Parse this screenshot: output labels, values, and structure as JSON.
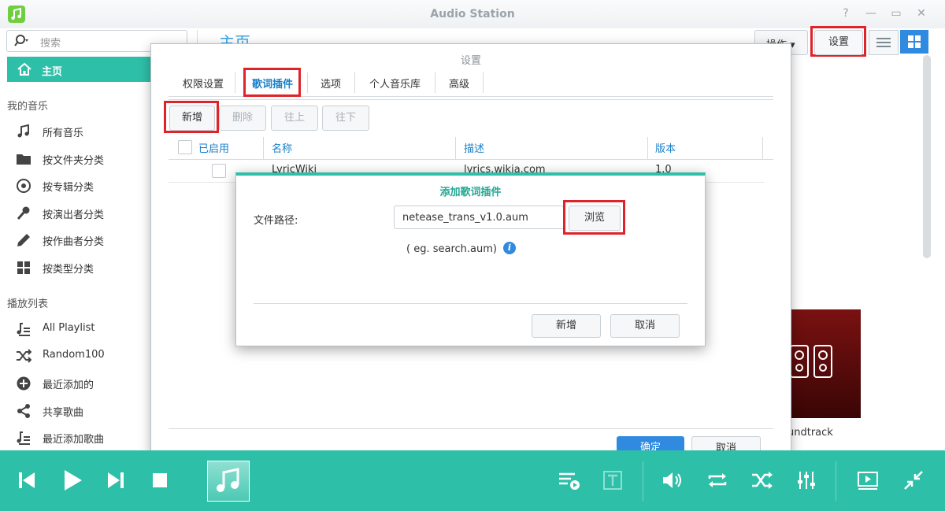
{
  "app": {
    "title": "Audio Station"
  },
  "search": {
    "placeholder": "搜索"
  },
  "sidebar": {
    "home_label": "主页",
    "my_music_label": "我的音乐",
    "my_music": [
      {
        "label": "所有音乐",
        "icon": "music-note-icon"
      },
      {
        "label": "按文件夹分类",
        "icon": "folder-icon"
      },
      {
        "label": "按专辑分类",
        "icon": "album-disc-icon"
      },
      {
        "label": "按演出者分类",
        "icon": "microphone-icon"
      },
      {
        "label": "按作曲者分类",
        "icon": "pen-icon"
      },
      {
        "label": "按类型分类",
        "icon": "grid-icon"
      }
    ],
    "playlist_label": "播放列表",
    "playlists": [
      {
        "label": "All Playlist",
        "icon": "playlist-icon"
      },
      {
        "label": "Random100",
        "icon": "shuffle-icon"
      },
      {
        "label": "最近添加的",
        "icon": "plus-circle-icon"
      },
      {
        "label": "共享歌曲",
        "icon": "share-icon"
      },
      {
        "label": "最近添加歌曲",
        "icon": "playlist-icon"
      }
    ]
  },
  "main": {
    "title": "主页",
    "ops_label": "操作",
    "settings_label": "设置",
    "album_caption": "undtrack"
  },
  "settings_dialog": {
    "title": "设置",
    "tabs": [
      "权限设置",
      "歌词插件",
      "选项",
      "个人音乐库",
      "高级"
    ],
    "active_tab": "歌词插件",
    "toolbar": {
      "add": "新增",
      "delete": "删除",
      "up": "往上",
      "down": "往下"
    },
    "columns": {
      "enabled": "已启用",
      "name": "名称",
      "description": "描述",
      "version": "版本"
    },
    "rows": [
      {
        "name": "LyricWiki",
        "description": "lyrics.wikia.com",
        "version": "1.0"
      }
    ],
    "ok_label": "确定",
    "cancel_label": "取消"
  },
  "add_plugin_dialog": {
    "title": "添加歌词插件",
    "path_label": "文件路径:",
    "path_value": "netease_trans_v1.0.aum",
    "browse_label": "浏览",
    "hint": "( eg. search.aum)",
    "add_label": "新增",
    "cancel_label": "取消"
  },
  "colors": {
    "accent": "#2ebfa8",
    "primary_blue": "#2f8ae0",
    "highlight_red": "#e0232a"
  }
}
